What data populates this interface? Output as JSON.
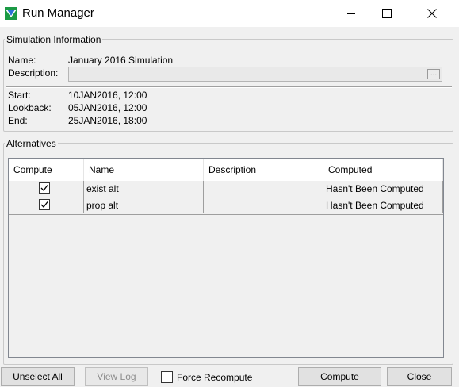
{
  "window": {
    "title": "Run Manager",
    "app_icon": "hec-ras-icon",
    "controls": {
      "minimize": "minimize-icon",
      "maximize": "maximize-icon",
      "close": "close-icon"
    }
  },
  "simulation_info": {
    "legend": "Simulation Information",
    "name_label": "Name:",
    "name_value": "January 2016 Simulation",
    "description_label": "Description:",
    "description_value": "",
    "description_button": "...",
    "start_label": "Start:",
    "start_value": "10JAN2016, 12:00",
    "lookback_label": "Lookback:",
    "lookback_value": "05JAN2016, 12:00",
    "end_label": "End:",
    "end_value": "25JAN2016, 18:00"
  },
  "alternatives": {
    "legend": "Alternatives",
    "columns": [
      "Compute",
      "Name",
      "Description",
      "Computed"
    ],
    "rows": [
      {
        "compute": true,
        "name": "exist alt",
        "description": "",
        "computed": "Hasn't Been Computed"
      },
      {
        "compute": true,
        "name": "prop alt",
        "description": "",
        "computed": "Hasn't Been Computed"
      }
    ]
  },
  "footer": {
    "unselect_all": "Unselect All",
    "view_log": "View Log",
    "force_recompute": "Force Recompute",
    "force_recompute_checked": false,
    "compute": "Compute",
    "close": "Close"
  },
  "colors": {
    "window_bg": "#f0f0f0",
    "titlebar_bg": "#ffffff",
    "button_bg": "#e1e1e1",
    "disabled_text": "#8d8d8d"
  }
}
